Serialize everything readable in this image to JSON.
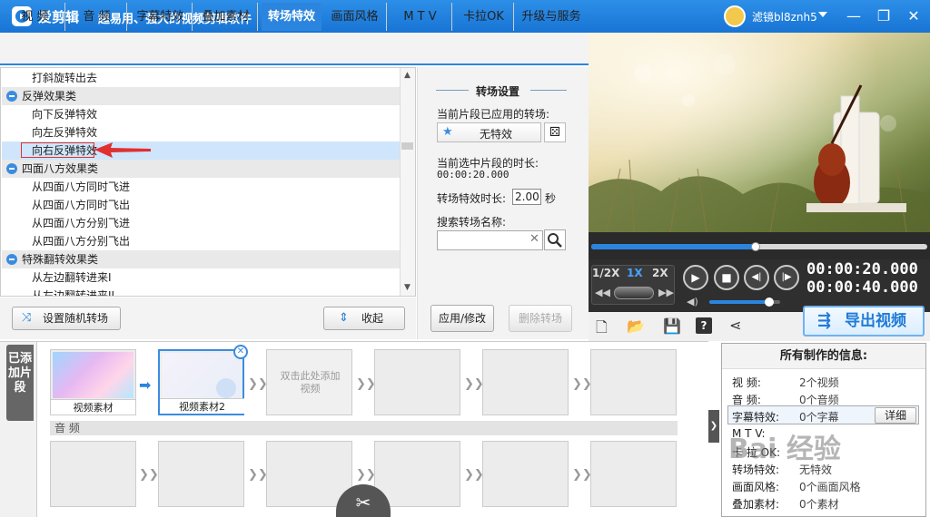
{
  "app": {
    "name": "爱剪辑",
    "slogan": "超易用、强大的视频剪辑软件",
    "username": "滤镜bl8znh5"
  },
  "window": {
    "minimize": "—",
    "restore": "❐",
    "close": "✕"
  },
  "tabs": [
    {
      "label": "视  频",
      "active": false
    },
    {
      "label": "音  频",
      "active": false
    },
    {
      "label": "字幕特效",
      "active": false
    },
    {
      "label": "叠加素材",
      "active": false
    },
    {
      "label": "转场特效",
      "active": true
    },
    {
      "label": "画面风格",
      "active": false
    },
    {
      "label": "M T V",
      "active": false
    },
    {
      "label": "卡拉OK",
      "active": false
    },
    {
      "label": "升级与服务",
      "active": false
    }
  ],
  "transition_list": {
    "rows": [
      {
        "type": "item",
        "label": "打斜旋转出去"
      },
      {
        "type": "group",
        "label": "反弹效果类"
      },
      {
        "type": "item",
        "label": "向下反弹特效"
      },
      {
        "type": "item",
        "label": "向左反弹特效"
      },
      {
        "type": "item",
        "label": "向右反弹特效",
        "selected": true
      },
      {
        "type": "group",
        "label": "四面八方效果类"
      },
      {
        "type": "item",
        "label": "从四面八方同时飞进"
      },
      {
        "type": "item",
        "label": "从四面八方同时飞出"
      },
      {
        "type": "item",
        "label": "从四面八方分别飞进"
      },
      {
        "type": "item",
        "label": "从四面八方分别飞出"
      },
      {
        "type": "group",
        "label": "特殊翻转效果类"
      },
      {
        "type": "item",
        "label": "从左边翻转进来I"
      },
      {
        "type": "item",
        "label": "从左边翻转进来II"
      }
    ]
  },
  "left_buttons": {
    "random": "设置随机转场",
    "collapse": "收起"
  },
  "settings": {
    "title": "转场设置",
    "applied_label": "当前片段已应用的转场:",
    "applied_value": "无特效",
    "clip_duration_label": "当前选中片段的时长:",
    "clip_duration_value": "00:00:20.000",
    "fx_duration_label": "转场特效时长:",
    "fx_duration_value": "2.00",
    "fx_duration_unit": "秒",
    "search_label": "搜索转场名称:",
    "search_value": "",
    "apply_button": "应用/修改",
    "delete_button": "删除转场"
  },
  "player": {
    "progress": 0.49,
    "speeds": [
      "1/2X",
      "1X",
      "2X"
    ],
    "active_speed": "1X",
    "time_current": "00:00:20.000",
    "time_total": "00:00:40.000",
    "volume": 0.85,
    "export_button": "导出视频"
  },
  "timeline": {
    "side_tab": "已添加片段",
    "clips": [
      {
        "label": "视频素材",
        "type": "video"
      },
      {
        "label": "视频素材2",
        "type": "video",
        "selected": true
      },
      {
        "label": "双击此处添加视频",
        "type": "placeholder"
      },
      {
        "label": "",
        "type": "empty"
      },
      {
        "label": "",
        "type": "empty"
      },
      {
        "label": "",
        "type": "empty"
      }
    ],
    "audio_label": "音 频"
  },
  "info_panel": {
    "title": "所有制作的信息:",
    "rows": [
      {
        "label": "视    频:",
        "value": "2个视频"
      },
      {
        "label": "音    频:",
        "value": "0个音频"
      },
      {
        "label": "字幕特效:",
        "value": "0个字幕"
      },
      {
        "label": "M  T  V:",
        "value": ""
      },
      {
        "label": "卡 拉 OK:",
        "value": ""
      },
      {
        "label": "转场特效:",
        "value": "无特效"
      },
      {
        "label": "画面风格:",
        "value": "0个画面风格"
      },
      {
        "label": "叠加素材:",
        "value": "0个素材"
      }
    ],
    "detail_button": "详细",
    "watermark": "Bai 经验"
  },
  "colors": {
    "accent": "#2b85de",
    "titlebar": "#1f7fdc",
    "selected": "#cfe5fb",
    "marker": "#e03030"
  }
}
